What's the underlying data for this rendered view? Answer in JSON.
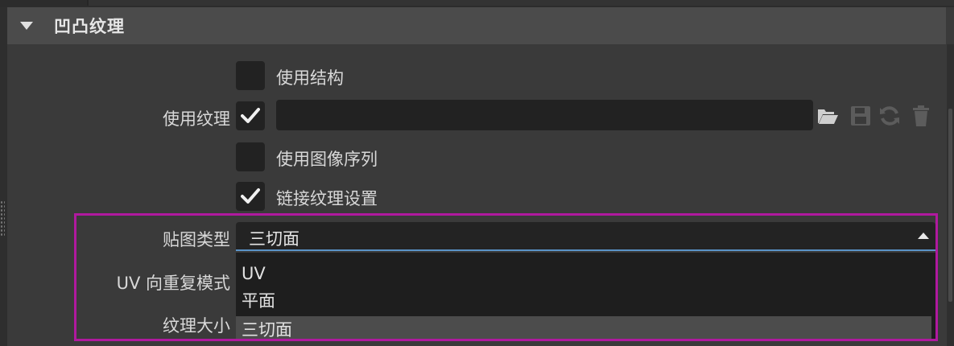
{
  "section": {
    "title": "凹凸纹理"
  },
  "rows": {
    "use_structure": {
      "label": "使用结构",
      "checked": false
    },
    "use_texture": {
      "label": "使用纹理",
      "checked": true,
      "path_value": ""
    },
    "use_image_sequence": {
      "label": "使用图像序列",
      "checked": false
    },
    "link_texture_settings": {
      "label": "链接纹理设置",
      "checked": true
    },
    "mapping_type": {
      "label": "贴图类型",
      "value": "三切面"
    },
    "uv_repeat_mode": {
      "label": "UV 向重复模式"
    },
    "texture_size": {
      "label": "纹理大小"
    }
  },
  "dropdown": {
    "options": [
      "UV",
      "平面",
      "三切面"
    ],
    "selected_index": 2
  },
  "toolbar_icons": [
    "folder-open-icon",
    "save-icon",
    "refresh-icon",
    "trash-icon"
  ],
  "colors": {
    "highlight": "#b0199f",
    "focus_underline": "#5a93c8"
  }
}
